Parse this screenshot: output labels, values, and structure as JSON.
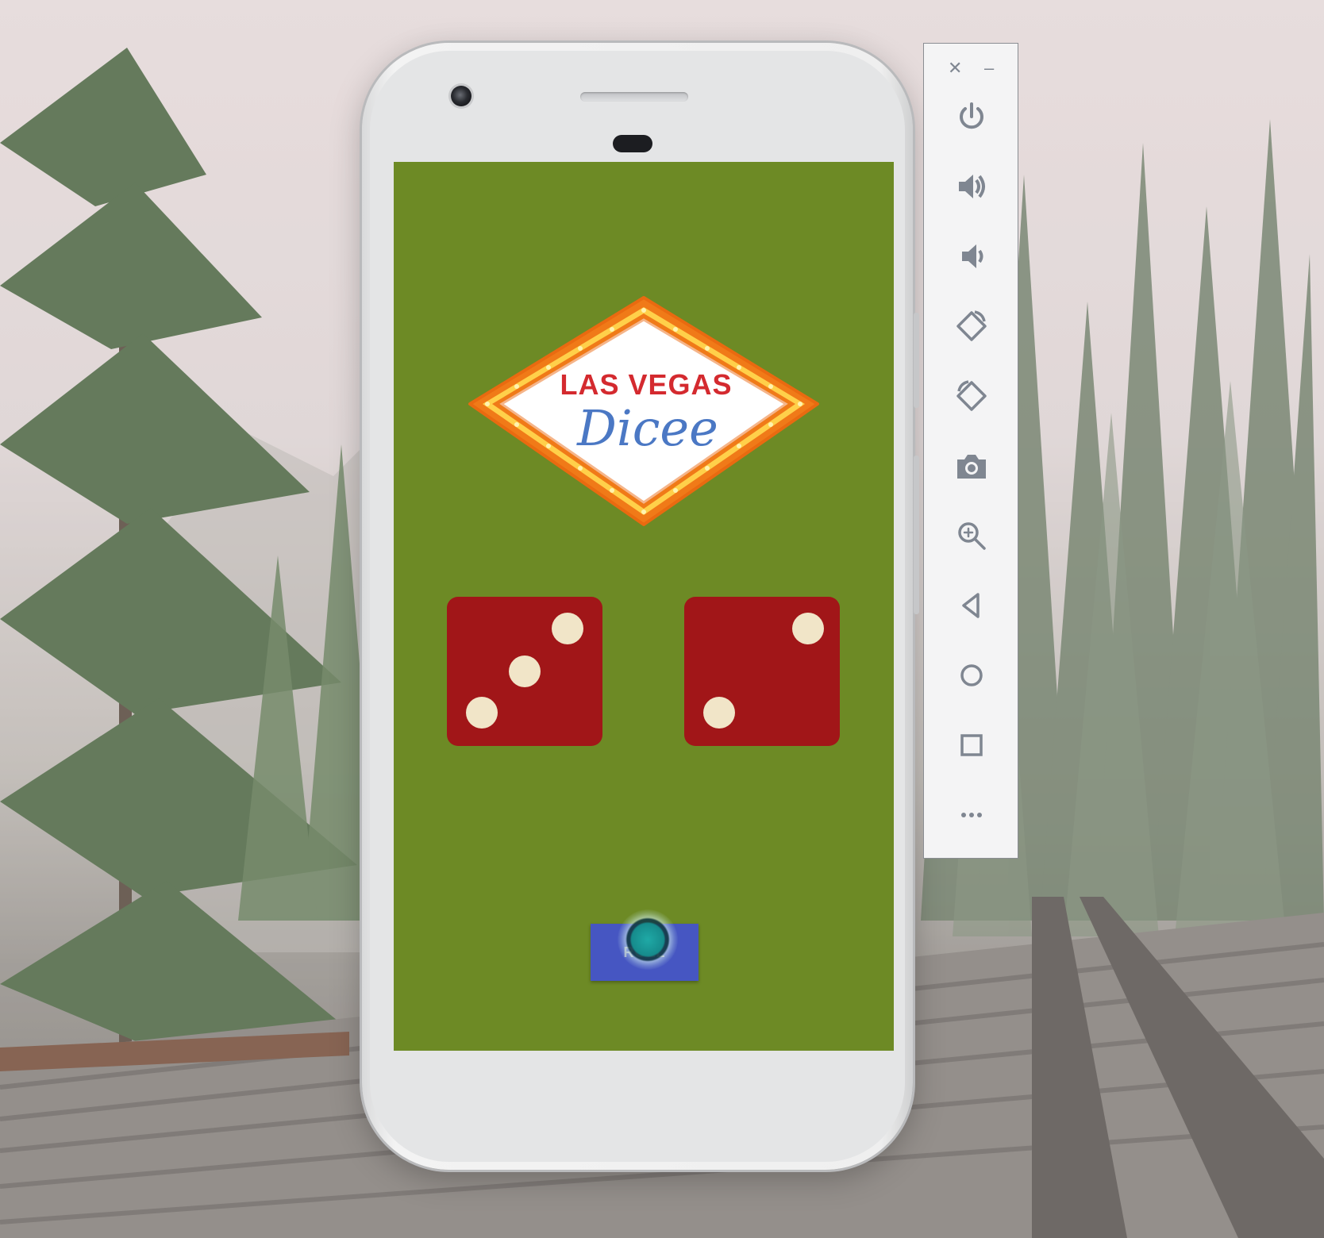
{
  "app": {
    "logo_line1": "LAS VEGAS",
    "logo_line2": "Dicee",
    "roll_button_label": "ROLL"
  },
  "dice": [
    {
      "name": "left-dice",
      "value": 3
    },
    {
      "name": "right-dice",
      "value": 2
    }
  ],
  "emulator_toolbar": {
    "window_controls": [
      "close-icon",
      "minimize-icon"
    ],
    "buttons": [
      "power-icon",
      "volume-up-icon",
      "volume-down-icon",
      "rotate-left-icon",
      "rotate-right-icon",
      "camera-icon",
      "zoom-icon",
      "back-icon",
      "home-icon",
      "overview-icon",
      "more-icon"
    ]
  },
  "colors": {
    "felt_green": "#6d8a25",
    "dice_red": "#a11618",
    "pip_cream": "#f1e5c8",
    "button_blue": "#4656c2",
    "logo_red": "#d42a2f",
    "logo_blue": "#4b78c4",
    "logo_orange": "#f07a18",
    "toolbar_icon": "#7f8691"
  }
}
